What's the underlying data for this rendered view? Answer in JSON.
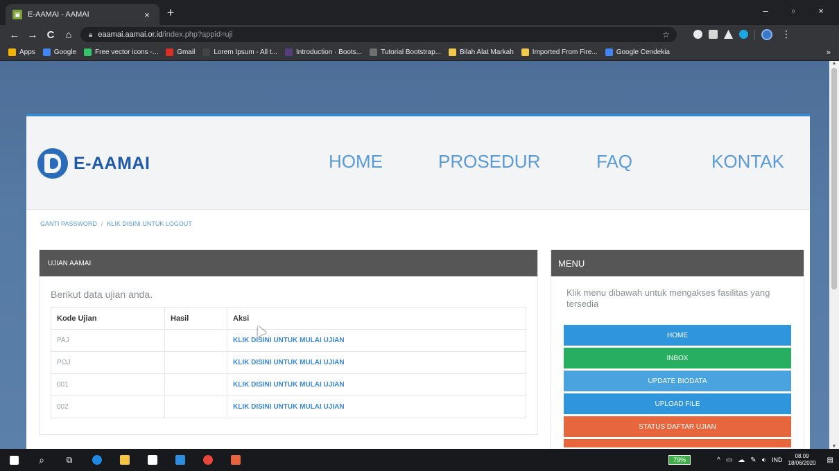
{
  "browser": {
    "tab_title": "E-AAMAI - AAMAI",
    "tab_close": "×",
    "new_tab": "+",
    "url_host": "eaamai.aamai.or.id",
    "url_path": "/index.php?appid=uji",
    "nav": {
      "back": "←",
      "forward": "→",
      "reload": "C",
      "home": "⌂"
    },
    "window": {
      "minimize": "–",
      "maximize": "▫",
      "close": "×"
    },
    "bookmarks": [
      {
        "label": "Apps",
        "color": "#f4b400"
      },
      {
        "label": "Google",
        "color": "#4285f4"
      },
      {
        "label": "Free vector icons -...",
        "color": "#36c46a"
      },
      {
        "label": "Gmail",
        "color": "#d93025"
      },
      {
        "label": "Lorem Ipsum - All t...",
        "color": "#444444"
      },
      {
        "label": "Introduction · Boots...",
        "color": "#563d7c"
      },
      {
        "label": "Tutorial Bootstrap...",
        "color": "#6f6f6f"
      },
      {
        "label": "Bilah Alat Markah",
        "color": "#f2c94c"
      },
      {
        "label": "Imported From Fire...",
        "color": "#f2c94c"
      },
      {
        "label": "Google Cendekia",
        "color": "#4285f4"
      }
    ],
    "bookmarks_more": "»"
  },
  "site": {
    "logo_text": "E-AAMAI",
    "nav": [
      {
        "label": "HOME"
      },
      {
        "label": "PROSEDUR"
      },
      {
        "label": "FAQ"
      },
      {
        "label": "KONTAK"
      }
    ],
    "breadcrumb": {
      "change_password": "GANTI PASSWORD",
      "separator": "/",
      "logout": "KLIK DISINI UNTUK LOGOUT"
    }
  },
  "exam_panel": {
    "title": "UJIAN AAMAI",
    "intro": "Berikut data ujian anda.",
    "columns": [
      "Kode Ujian",
      "Hasil",
      "Aksi"
    ],
    "rows": [
      {
        "code": "PAJ",
        "result": "",
        "action": "KLIK DISINI UNTUK MULAI UJIAN"
      },
      {
        "code": "POJ",
        "result": "",
        "action": "KLIK DISINI UNTUK MULAI UJIAN"
      },
      {
        "code": "001",
        "result": "",
        "action": "KLIK DISINI UNTUK MULAI UJIAN"
      },
      {
        "code": "002",
        "result": "",
        "action": "KLIK DISINI UNTUK MULAI UJIAN"
      }
    ]
  },
  "menu_panel": {
    "title": "MENU",
    "intro": "Klik menu dibawah untuk mengakses fasilitas yang tersedia",
    "buttons": [
      {
        "label": "HOME",
        "color": "#2f95dc"
      },
      {
        "label": "INBOX",
        "color": "#27ae60"
      },
      {
        "label": "UPDATE BIODATA",
        "color": "#4aa3df"
      },
      {
        "label": "UPLOAD FILE",
        "color": "#2f95dc"
      },
      {
        "label": "STATUS DAFTAR UJIAN",
        "color": "#e8663d"
      }
    ]
  },
  "taskbar": {
    "battery": "79%",
    "language": "IND",
    "time": "08.09",
    "date": "18/06/2020"
  }
}
